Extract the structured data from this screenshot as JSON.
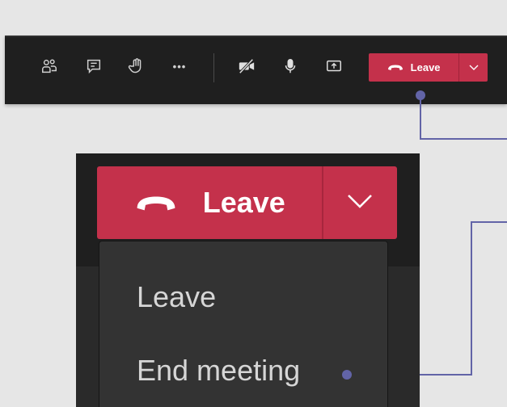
{
  "toolbar": {
    "icons": [
      "participants-icon",
      "chat-icon",
      "raise-hand-icon",
      "more-options-icon",
      "camera-off-icon",
      "microphone-icon",
      "share-screen-icon"
    ],
    "more_glyph": "•••",
    "leave_label": "Leave"
  },
  "zoom": {
    "leave_label": "Leave",
    "menu": {
      "items": [
        "Leave",
        "End meeting"
      ]
    }
  },
  "colors": {
    "background": "#e6e6e6",
    "toolbar": "#1f1f1f",
    "leave_red": "#c4314b",
    "connector": "#6264a7",
    "menu_bg": "#333333",
    "menu_text": "#d6d6d6"
  }
}
